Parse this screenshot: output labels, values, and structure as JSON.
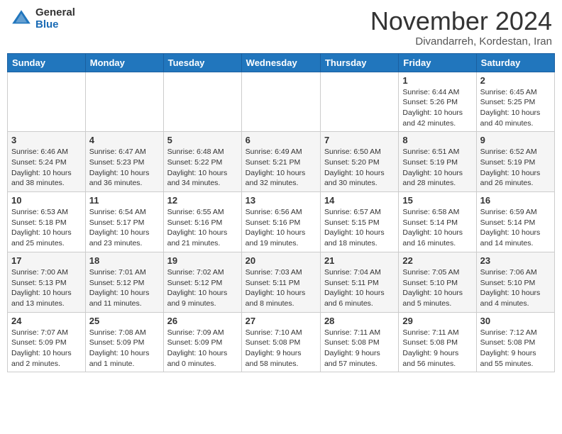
{
  "header": {
    "logo": {
      "general": "General",
      "blue": "Blue"
    },
    "month": "November 2024",
    "location": "Divandarreh, Kordestan, Iran"
  },
  "weekdays": [
    "Sunday",
    "Monday",
    "Tuesday",
    "Wednesday",
    "Thursday",
    "Friday",
    "Saturday"
  ],
  "weeks": [
    [
      {
        "day": "",
        "info": ""
      },
      {
        "day": "",
        "info": ""
      },
      {
        "day": "",
        "info": ""
      },
      {
        "day": "",
        "info": ""
      },
      {
        "day": "",
        "info": ""
      },
      {
        "day": "1",
        "info": "Sunrise: 6:44 AM\nSunset: 5:26 PM\nDaylight: 10 hours\nand 42 minutes."
      },
      {
        "day": "2",
        "info": "Sunrise: 6:45 AM\nSunset: 5:25 PM\nDaylight: 10 hours\nand 40 minutes."
      }
    ],
    [
      {
        "day": "3",
        "info": "Sunrise: 6:46 AM\nSunset: 5:24 PM\nDaylight: 10 hours\nand 38 minutes."
      },
      {
        "day": "4",
        "info": "Sunrise: 6:47 AM\nSunset: 5:23 PM\nDaylight: 10 hours\nand 36 minutes."
      },
      {
        "day": "5",
        "info": "Sunrise: 6:48 AM\nSunset: 5:22 PM\nDaylight: 10 hours\nand 34 minutes."
      },
      {
        "day": "6",
        "info": "Sunrise: 6:49 AM\nSunset: 5:21 PM\nDaylight: 10 hours\nand 32 minutes."
      },
      {
        "day": "7",
        "info": "Sunrise: 6:50 AM\nSunset: 5:20 PM\nDaylight: 10 hours\nand 30 minutes."
      },
      {
        "day": "8",
        "info": "Sunrise: 6:51 AM\nSunset: 5:19 PM\nDaylight: 10 hours\nand 28 minutes."
      },
      {
        "day": "9",
        "info": "Sunrise: 6:52 AM\nSunset: 5:19 PM\nDaylight: 10 hours\nand 26 minutes."
      }
    ],
    [
      {
        "day": "10",
        "info": "Sunrise: 6:53 AM\nSunset: 5:18 PM\nDaylight: 10 hours\nand 25 minutes."
      },
      {
        "day": "11",
        "info": "Sunrise: 6:54 AM\nSunset: 5:17 PM\nDaylight: 10 hours\nand 23 minutes."
      },
      {
        "day": "12",
        "info": "Sunrise: 6:55 AM\nSunset: 5:16 PM\nDaylight: 10 hours\nand 21 minutes."
      },
      {
        "day": "13",
        "info": "Sunrise: 6:56 AM\nSunset: 5:16 PM\nDaylight: 10 hours\nand 19 minutes."
      },
      {
        "day": "14",
        "info": "Sunrise: 6:57 AM\nSunset: 5:15 PM\nDaylight: 10 hours\nand 18 minutes."
      },
      {
        "day": "15",
        "info": "Sunrise: 6:58 AM\nSunset: 5:14 PM\nDaylight: 10 hours\nand 16 minutes."
      },
      {
        "day": "16",
        "info": "Sunrise: 6:59 AM\nSunset: 5:14 PM\nDaylight: 10 hours\nand 14 minutes."
      }
    ],
    [
      {
        "day": "17",
        "info": "Sunrise: 7:00 AM\nSunset: 5:13 PM\nDaylight: 10 hours\nand 13 minutes."
      },
      {
        "day": "18",
        "info": "Sunrise: 7:01 AM\nSunset: 5:12 PM\nDaylight: 10 hours\nand 11 minutes."
      },
      {
        "day": "19",
        "info": "Sunrise: 7:02 AM\nSunset: 5:12 PM\nDaylight: 10 hours\nand 9 minutes."
      },
      {
        "day": "20",
        "info": "Sunrise: 7:03 AM\nSunset: 5:11 PM\nDaylight: 10 hours\nand 8 minutes."
      },
      {
        "day": "21",
        "info": "Sunrise: 7:04 AM\nSunset: 5:11 PM\nDaylight: 10 hours\nand 6 minutes."
      },
      {
        "day": "22",
        "info": "Sunrise: 7:05 AM\nSunset: 5:10 PM\nDaylight: 10 hours\nand 5 minutes."
      },
      {
        "day": "23",
        "info": "Sunrise: 7:06 AM\nSunset: 5:10 PM\nDaylight: 10 hours\nand 4 minutes."
      }
    ],
    [
      {
        "day": "24",
        "info": "Sunrise: 7:07 AM\nSunset: 5:09 PM\nDaylight: 10 hours\nand 2 minutes."
      },
      {
        "day": "25",
        "info": "Sunrise: 7:08 AM\nSunset: 5:09 PM\nDaylight: 10 hours\nand 1 minute."
      },
      {
        "day": "26",
        "info": "Sunrise: 7:09 AM\nSunset: 5:09 PM\nDaylight: 10 hours\nand 0 minutes."
      },
      {
        "day": "27",
        "info": "Sunrise: 7:10 AM\nSunset: 5:08 PM\nDaylight: 9 hours\nand 58 minutes."
      },
      {
        "day": "28",
        "info": "Sunrise: 7:11 AM\nSunset: 5:08 PM\nDaylight: 9 hours\nand 57 minutes."
      },
      {
        "day": "29",
        "info": "Sunrise: 7:11 AM\nSunset: 5:08 PM\nDaylight: 9 hours\nand 56 minutes."
      },
      {
        "day": "30",
        "info": "Sunrise: 7:12 AM\nSunset: 5:08 PM\nDaylight: 9 hours\nand 55 minutes."
      }
    ]
  ]
}
